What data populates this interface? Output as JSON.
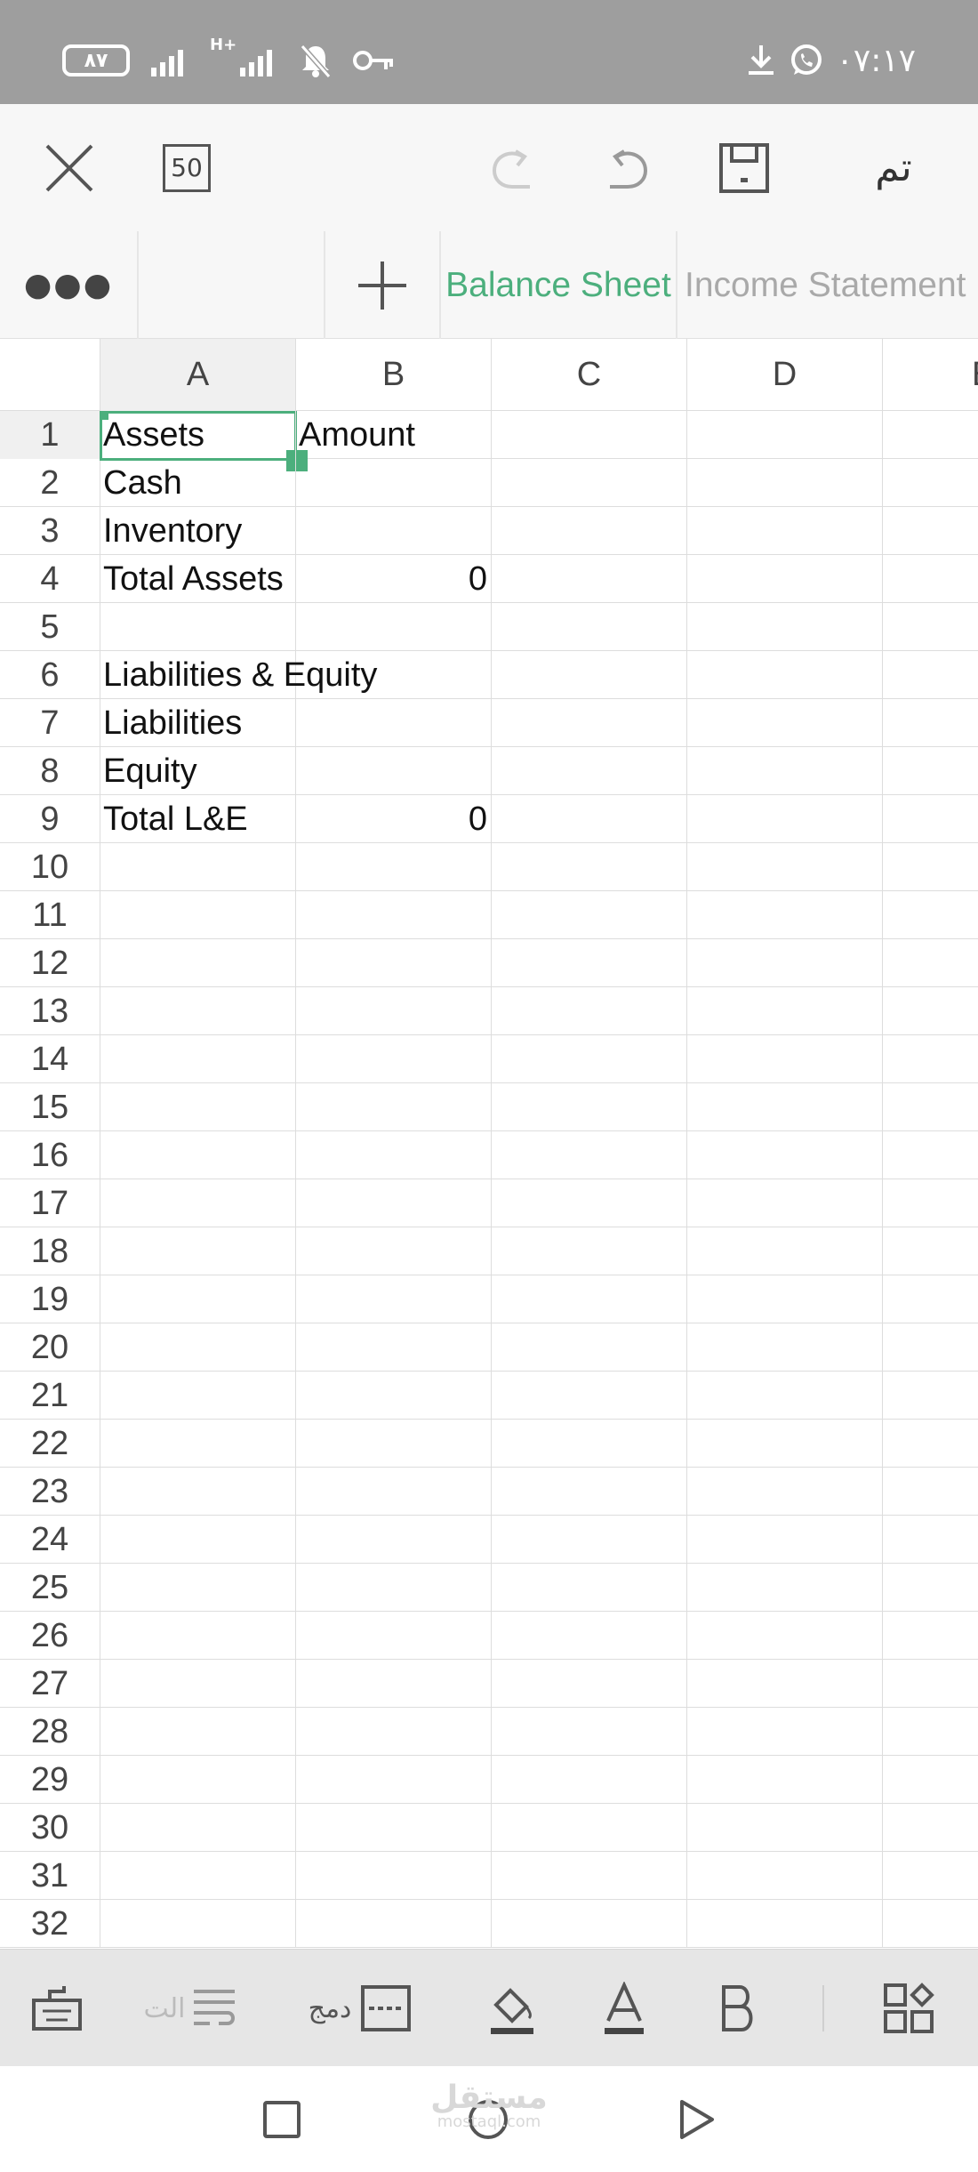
{
  "status_bar": {
    "battery": "٨٧",
    "network": "H+",
    "time": "٠٧:١٧"
  },
  "toolbar": {
    "zoom": "50",
    "done_label": "تم"
  },
  "sheet_tabs": [
    {
      "label": "Balance Sheet",
      "active": true
    },
    {
      "label": "Income Statement",
      "active": false
    }
  ],
  "columns": [
    "A",
    "B",
    "C",
    "D",
    "E"
  ],
  "rows": [
    {
      "num": "1",
      "a": "Assets",
      "b": "Amount",
      "b_numeric": false
    },
    {
      "num": "2",
      "a": "Cash",
      "b": "",
      "b_numeric": false
    },
    {
      "num": "3",
      "a": "Inventory",
      "b": "",
      "b_numeric": false
    },
    {
      "num": "4",
      "a": "Total Assets",
      "b": "0",
      "b_numeric": true
    },
    {
      "num": "5",
      "a": "",
      "b": "",
      "b_numeric": false
    },
    {
      "num": "6",
      "a": "Liabilities & Equity",
      "b": "",
      "b_numeric": false
    },
    {
      "num": "7",
      "a": "Liabilities",
      "b": "",
      "b_numeric": false
    },
    {
      "num": "8",
      "a": "Equity",
      "b": "",
      "b_numeric": false
    },
    {
      "num": "9",
      "a": "Total L&E",
      "b": "0",
      "b_numeric": true
    },
    {
      "num": "10",
      "a": "",
      "b": "",
      "b_numeric": false
    },
    {
      "num": "11",
      "a": "",
      "b": "",
      "b_numeric": false
    },
    {
      "num": "12",
      "a": "",
      "b": "",
      "b_numeric": false
    },
    {
      "num": "13",
      "a": "",
      "b": "",
      "b_numeric": false
    },
    {
      "num": "14",
      "a": "",
      "b": "",
      "b_numeric": false
    },
    {
      "num": "15",
      "a": "",
      "b": "",
      "b_numeric": false
    },
    {
      "num": "16",
      "a": "",
      "b": "",
      "b_numeric": false
    },
    {
      "num": "17",
      "a": "",
      "b": "",
      "b_numeric": false
    },
    {
      "num": "18",
      "a": "",
      "b": "",
      "b_numeric": false
    },
    {
      "num": "19",
      "a": "",
      "b": "",
      "b_numeric": false
    },
    {
      "num": "20",
      "a": "",
      "b": "",
      "b_numeric": false
    },
    {
      "num": "21",
      "a": "",
      "b": "",
      "b_numeric": false
    },
    {
      "num": "22",
      "a": "",
      "b": "",
      "b_numeric": false
    },
    {
      "num": "23",
      "a": "",
      "b": "",
      "b_numeric": false
    },
    {
      "num": "24",
      "a": "",
      "b": "",
      "b_numeric": false
    },
    {
      "num": "25",
      "a": "",
      "b": "",
      "b_numeric": false
    },
    {
      "num": "26",
      "a": "",
      "b": "",
      "b_numeric": false
    },
    {
      "num": "27",
      "a": "",
      "b": "",
      "b_numeric": false
    },
    {
      "num": "28",
      "a": "",
      "b": "",
      "b_numeric": false
    },
    {
      "num": "29",
      "a": "",
      "b": "",
      "b_numeric": false
    },
    {
      "num": "30",
      "a": "",
      "b": "",
      "b_numeric": false
    },
    {
      "num": "31",
      "a": "",
      "b": "",
      "b_numeric": false
    },
    {
      "num": "32",
      "a": "",
      "b": "",
      "b_numeric": false
    }
  ],
  "selected_cell": "A1",
  "format_bar": {
    "wrap_label": "الت",
    "merge_label": "دمج"
  },
  "watermark": {
    "text": "مستقل",
    "sub": "mostaql.com"
  },
  "colors": {
    "accent": "#4caf7d",
    "status_bar": "#9e9e9e",
    "inactive_tab": "#a9a9a9"
  },
  "icons": {
    "toolbar": [
      "close-icon",
      "redo-icon",
      "undo-icon",
      "save-icon"
    ],
    "format_bar": [
      "keyboard-icon",
      "wrap-text-icon",
      "merge-cells-icon",
      "fill-color-icon",
      "font-color-icon",
      "bold-icon",
      "more-apps-icon"
    ],
    "nav": [
      "recents-icon",
      "home-icon",
      "back-icon"
    ]
  }
}
